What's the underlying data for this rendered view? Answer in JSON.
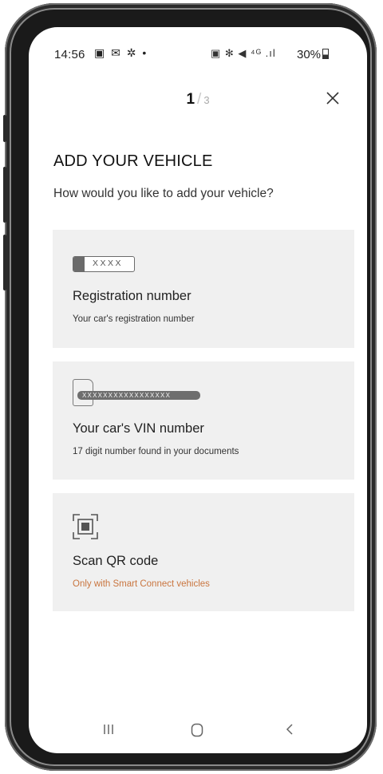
{
  "status_bar": {
    "time": "14:56",
    "left_icons": "▣ ✉ ✲ •",
    "right_icons": "▣ ✻ ◀ ⁴ᴳ .ıl",
    "battery": "30%"
  },
  "header": {
    "step_current": "1",
    "step_separator": "/",
    "step_total": "3",
    "close_icon": "close-icon"
  },
  "page": {
    "title": "ADD YOUR VEHICLE",
    "subtitle": "How would you like  to add your vehicle?"
  },
  "options": [
    {
      "icon": "license-plate-icon",
      "plate_text": "XXXX",
      "title": "Registration number",
      "description": "Your car's  registration number"
    },
    {
      "icon": "vin-document-icon",
      "vin_text": "XXXXXXXXXXXXXXXXX",
      "title": "Your car's VIN number",
      "description": "17 digit number found in your documents"
    },
    {
      "icon": "qr-scan-icon",
      "title": "Scan QR code",
      "description": "Only with Smart Connect vehicles",
      "description_color": "#c9753f"
    }
  ],
  "nav_bar": {
    "recents_icon": "recents-icon",
    "home_icon": "home-icon",
    "back_icon": "back-icon"
  },
  "colors": {
    "card_background": "#f0f0f0",
    "accent": "#c9753f",
    "text": "#222222"
  }
}
